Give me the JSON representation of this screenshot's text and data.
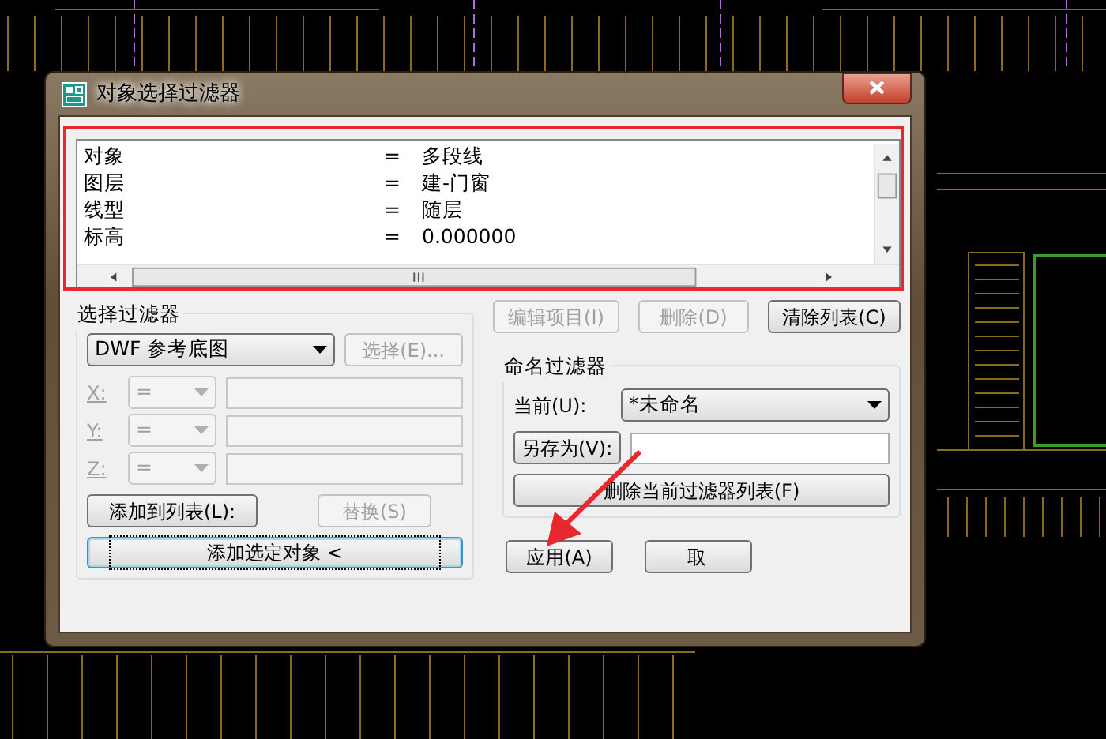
{
  "window": {
    "title": "对象选择过滤器"
  },
  "filter_list": {
    "rows": [
      {
        "property": "对象",
        "operator": "=",
        "value": "多段线"
      },
      {
        "property": "图层",
        "operator": "=",
        "value": "建-门窗"
      },
      {
        "property": "线型",
        "operator": "=",
        "value": "随层"
      },
      {
        "property": "标高",
        "operator": "=",
        "value": "0.000000"
      }
    ]
  },
  "select_filter": {
    "label": "选择过滤器",
    "dropdown": "DWF 参考底图",
    "select_button": {
      "label": "选择(E)...",
      "disabled": true
    },
    "coordinates": [
      {
        "axis": "X:",
        "operator": "=",
        "disabled": true
      },
      {
        "axis": "Y:",
        "operator": "=",
        "disabled": true
      },
      {
        "axis": "Z:",
        "operator": "=",
        "disabled": true
      }
    ],
    "buttons": [
      {
        "label": "添加到列表(L):",
        "disabled": false
      },
      {
        "label": "替换(S)",
        "disabled": true
      }
    ],
    "add_selected": {
      "label": "添加选定对象 <",
      "focused": true
    }
  },
  "list_buttons": [
    {
      "label": "编辑项目(I)",
      "disabled": true
    },
    {
      "label": "删除(D)",
      "disabled": true
    },
    {
      "label": "清除列表(C)",
      "disabled": false
    }
  ],
  "named_filters": {
    "label": "命名过滤器",
    "current_label": "当前(U):",
    "current_value": "*未命名",
    "save_as_button": "另存为(V):",
    "delete_button": "删除当前过滤器列表(F)"
  },
  "dialog_buttons": [
    {
      "label": "应用(A)"
    },
    {
      "label": "取"
    }
  ]
}
